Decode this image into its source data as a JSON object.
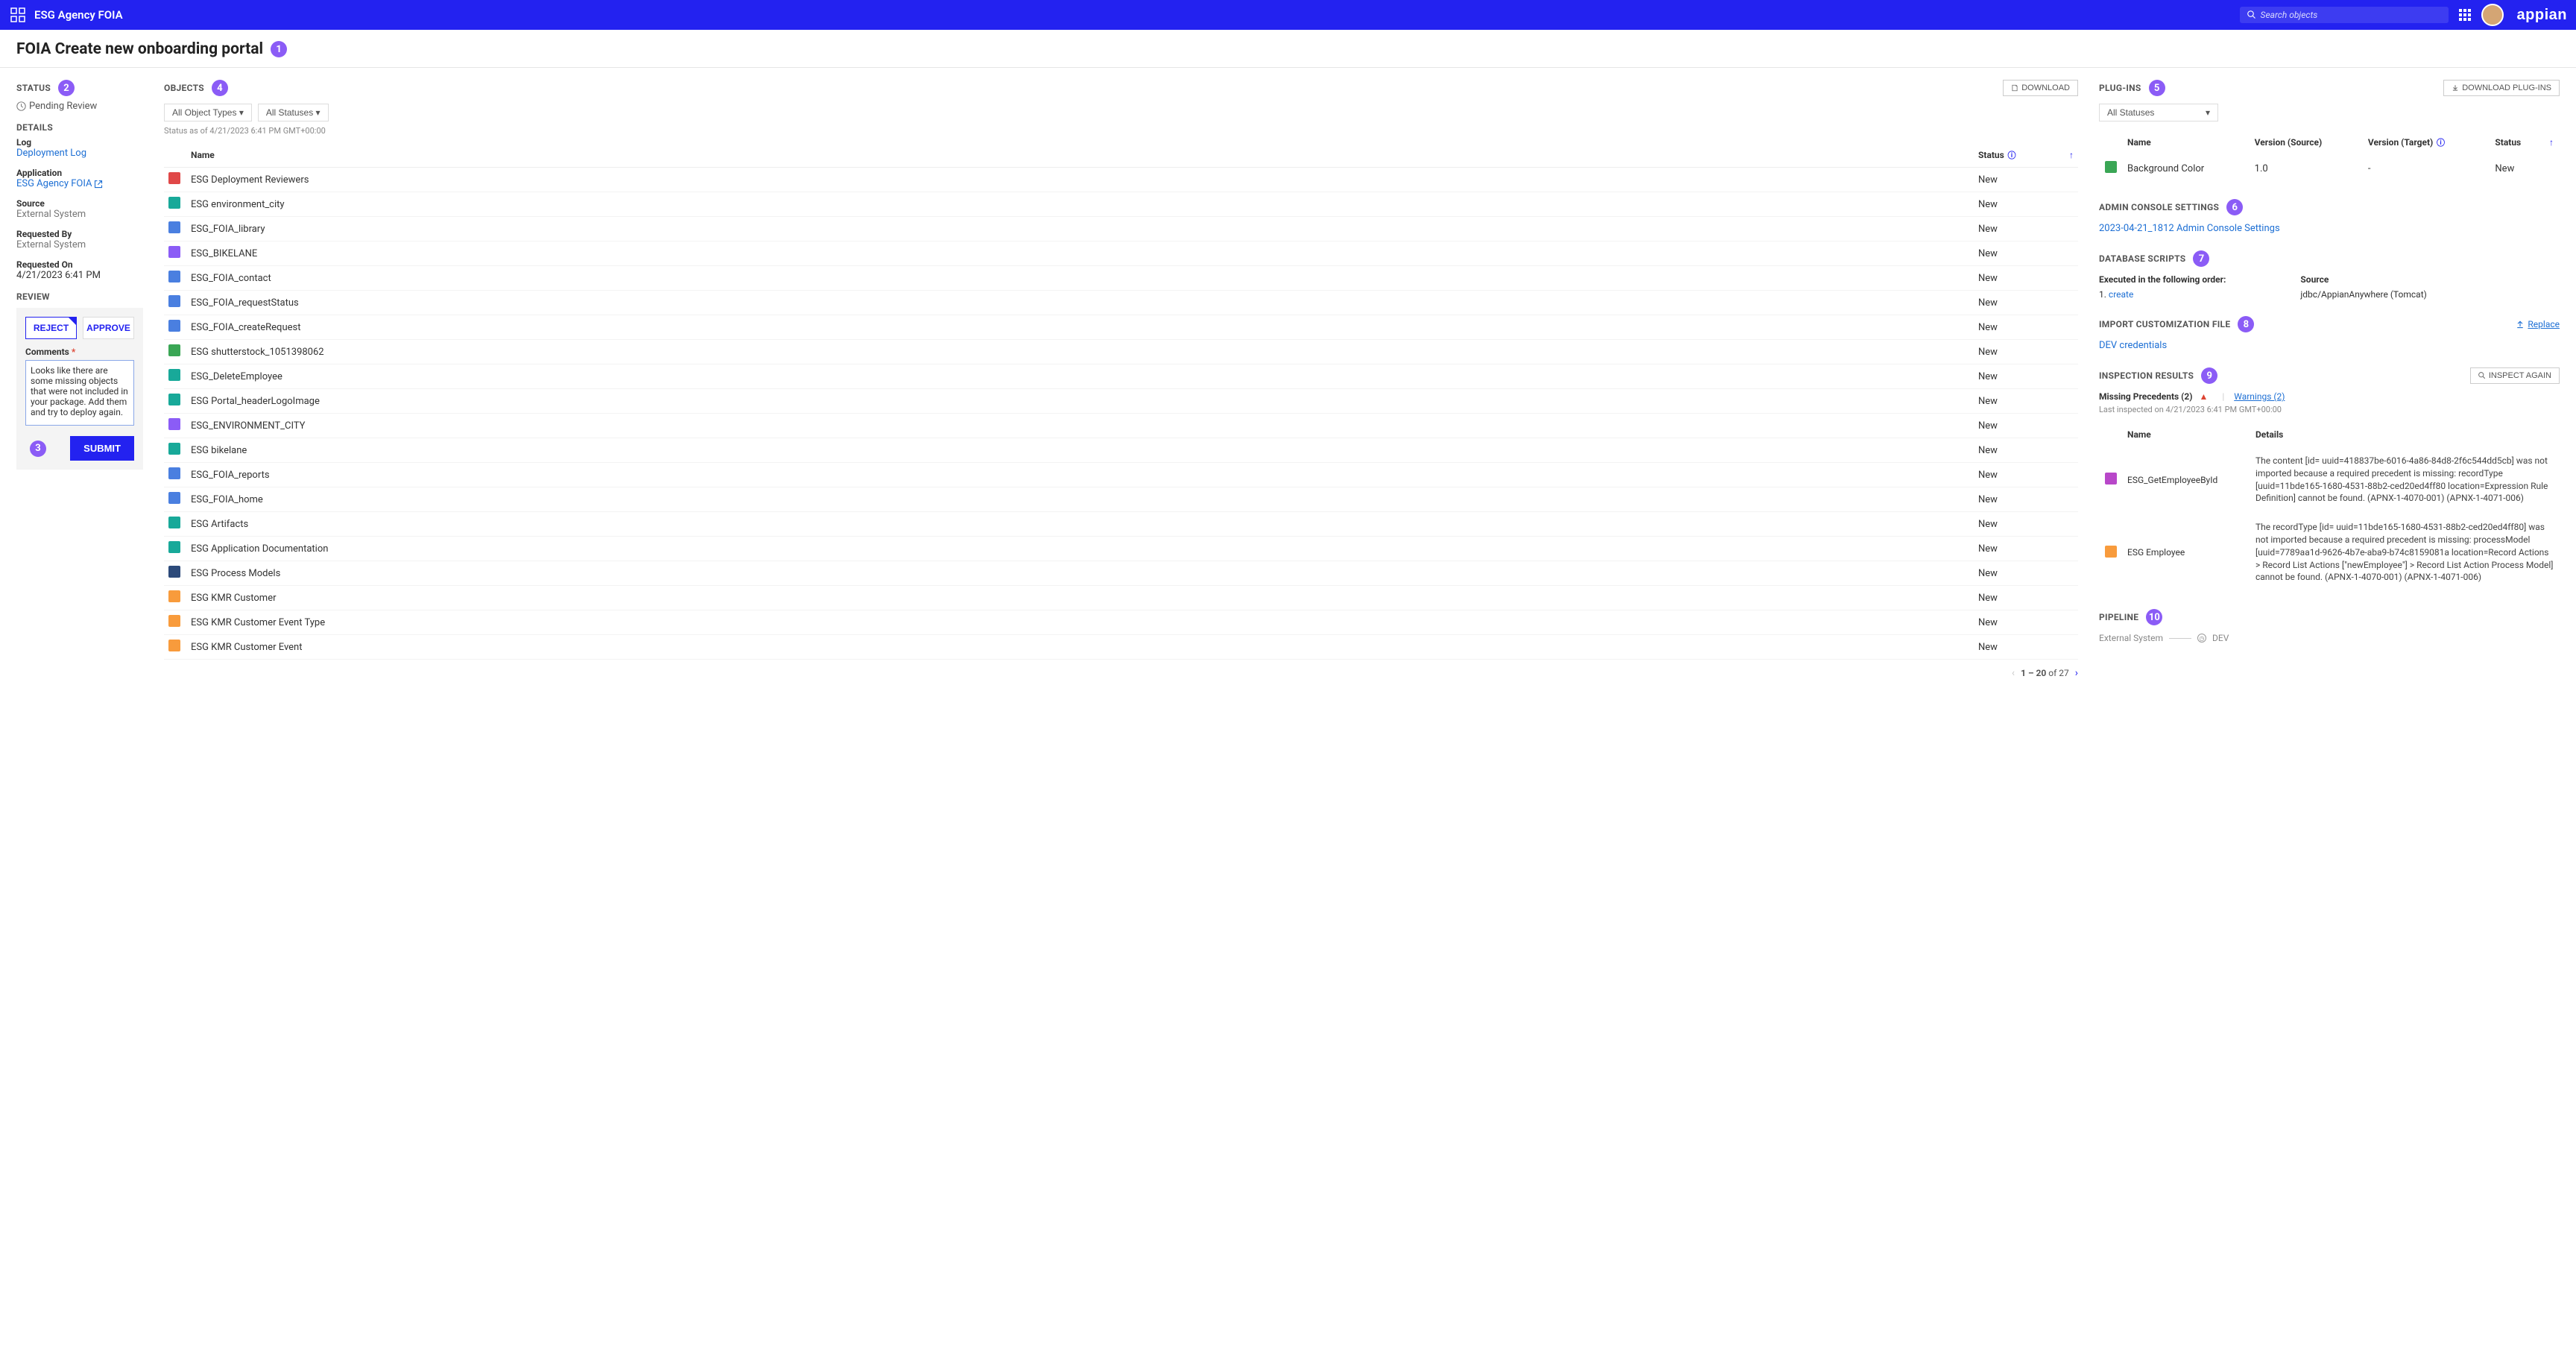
{
  "header": {
    "app_title": "ESG Agency FOIA",
    "search_placeholder": "Search objects",
    "logo_text": "appian"
  },
  "page": {
    "title": "FOIA Create new onboarding portal"
  },
  "annotations": [
    "1",
    "2",
    "3",
    "4",
    "5",
    "6",
    "7",
    "8",
    "9",
    "10"
  ],
  "status": {
    "section_label": "STATUS",
    "value": "Pending Review"
  },
  "details": {
    "section_label": "DETAILS",
    "log_label": "Log",
    "log_link": "Deployment Log",
    "application_label": "Application",
    "application_link": "ESG Agency FOIA",
    "source_label": "Source",
    "source_value": "External System",
    "requested_by_label": "Requested By",
    "requested_by_value": "External System",
    "requested_on_label": "Requested On",
    "requested_on_value": "4/21/2023 6:41 PM"
  },
  "review": {
    "section_label": "REVIEW",
    "reject_label": "REJECT",
    "approve_label": "APPROVE",
    "comments_label": "Comments",
    "comments_value": "Looks like there are some missing objects that were not included in your package. Add them and try to deploy again.",
    "submit_label": "SUBMIT"
  },
  "objects": {
    "section_label": "OBJECTS",
    "download_label": "DOWNLOAD",
    "filter_type": "All Object Types",
    "filter_status": "All Statuses",
    "status_timestamp": "Status as of 4/21/2023 6:41 PM GMT+00:00",
    "col_name": "Name",
    "col_status": "Status",
    "rows": [
      {
        "icon": "ic-red",
        "name": "ESG Deployment Reviewers",
        "status": "New"
      },
      {
        "icon": "ic-teal",
        "name": "ESG environment_city",
        "status": "New"
      },
      {
        "icon": "ic-blue",
        "name": "ESG_FOIA_library",
        "status": "New"
      },
      {
        "icon": "ic-purple",
        "name": "ESG_BIKELANE",
        "status": "New"
      },
      {
        "icon": "ic-blue",
        "name": "ESG_FOIA_contact",
        "status": "New"
      },
      {
        "icon": "ic-blue",
        "name": "ESG_FOIA_requestStatus",
        "status": "New"
      },
      {
        "icon": "ic-blue",
        "name": "ESG_FOIA_createRequest",
        "status": "New"
      },
      {
        "icon": "ic-green",
        "name": "ESG shutterstock_1051398062",
        "status": "New"
      },
      {
        "icon": "ic-teal",
        "name": "ESG_DeleteEmployee",
        "status": "New"
      },
      {
        "icon": "ic-teal",
        "name": "ESG Portal_headerLogoImage",
        "status": "New"
      },
      {
        "icon": "ic-purple",
        "name": "ESG_ENVIRONMENT_CITY",
        "status": "New"
      },
      {
        "icon": "ic-teal",
        "name": "ESG bikelane",
        "status": "New"
      },
      {
        "icon": "ic-blue",
        "name": "ESG_FOIA_reports",
        "status": "New"
      },
      {
        "icon": "ic-blue",
        "name": "ESG_FOIA_home",
        "status": "New"
      },
      {
        "icon": "ic-teal",
        "name": "ESG Artifacts",
        "status": "New"
      },
      {
        "icon": "ic-teal",
        "name": "ESG Application Documentation",
        "status": "New"
      },
      {
        "icon": "ic-navy",
        "name": "ESG Process Models",
        "status": "New"
      },
      {
        "icon": "ic-orange",
        "name": "ESG KMR Customer",
        "status": "New"
      },
      {
        "icon": "ic-orange",
        "name": "ESG KMR Customer Event Type",
        "status": "New"
      },
      {
        "icon": "ic-orange",
        "name": "ESG KMR Customer Event",
        "status": "New"
      }
    ],
    "pager": {
      "range": "1 – 20",
      "of": "of",
      "total": "27"
    }
  },
  "plugins": {
    "section_label": "PLUG-INS",
    "filter_status": "All Statuses",
    "download_label": "DOWNLOAD PLUG-INS",
    "col_name": "Name",
    "col_version_source": "Version (Source)",
    "col_version_target": "Version (Target)",
    "col_status": "Status",
    "rows": [
      {
        "icon": "ic-green",
        "name": "Background Color",
        "vs": "1.0",
        "vt": "-",
        "status": "New"
      }
    ]
  },
  "admin_console": {
    "section_label": "ADMIN CONSOLE SETTINGS",
    "link": "2023-04-21_1812 Admin Console Settings"
  },
  "database_scripts": {
    "section_label": "DATABASE SCRIPTS",
    "executed_label": "Executed in the following order:",
    "source_label": "Source",
    "item_num": "1.",
    "item_link": "create",
    "source_value": "jdbc/AppianAnywhere (Tomcat)"
  },
  "import_custom": {
    "section_label": "IMPORT CUSTOMIZATION FILE",
    "link": "DEV credentials",
    "replace_label": "Replace"
  },
  "inspection": {
    "section_label": "INSPECTION RESULTS",
    "inspect_again_label": "INSPECT AGAIN",
    "missing_precedents_label": "Missing Precedents (2)",
    "warnings_label": "Warnings (2)",
    "timestamp": "Last inspected on 4/21/2023 6:41 PM GMT+00:00",
    "col_name": "Name",
    "col_details": "Details",
    "rows": [
      {
        "icon": "ic-mag",
        "name": "ESG_GetEmployeeById",
        "details": "The content [id= uuid=418837be-6016-4a86-84d8-2f6c544dd5cb] was not imported because a required precedent is missing: recordType [uuid=11bde165-1680-4531-88b2-ced20ed4ff80 location=Expression Rule Definition] cannot be found. (APNX-1-4070-001) (APNX-1-4071-006)"
      },
      {
        "icon": "ic-orange",
        "name": "ESG Employee",
        "details": "The recordType [id= uuid=11bde165-1680-4531-88b2-ced20ed4ff80] was not imported because a required precedent is missing: processModel [uuid=7789aa1d-9626-4b7e-aba9-b74c8159081a location=Record Actions > Record List Actions [\"newEmployee\"] > Record List Action Process Model] cannot be found. (APNX-1-4070-001) (APNX-1-4071-006)"
      }
    ]
  },
  "pipeline": {
    "section_label": "PIPELINE",
    "external": "External System",
    "dev": "DEV"
  }
}
